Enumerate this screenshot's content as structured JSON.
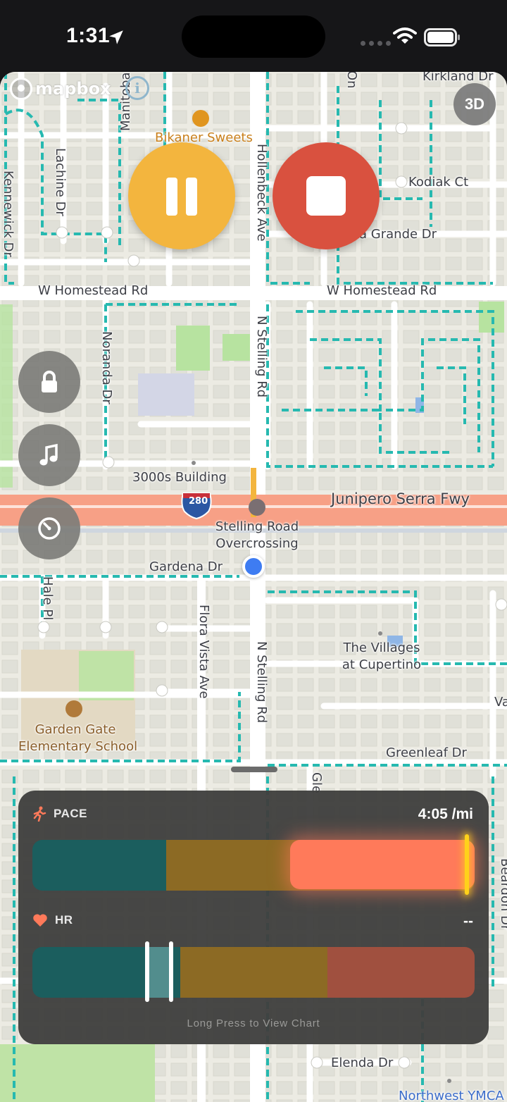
{
  "status_bar": {
    "time": "1:31",
    "location_icon": "location-arrow-icon",
    "wifi_icon": "wifi-icon",
    "battery_icon": "battery-icon"
  },
  "map": {
    "attribution": "mapbox",
    "info_icon": "info-icon",
    "info_glyph": "i",
    "view_toggle_label": "3D",
    "roads": {
      "kirkland": "Kirkland Dr",
      "kodiak": "Kodiak Ct",
      "la_grande": "La Grande Dr",
      "homestead_left": "W Homestead Rd",
      "homestead_right": "W Homestead Rd",
      "hollenbeck": "Hollenbeck Ave",
      "stelling_north": "N Stelling Rd",
      "stelling_south": "N Stelling Rd",
      "noranda": "Noranda Dr",
      "lachine": "Lachine Dr",
      "manitoba": "Manitoba Dr",
      "kennewick": "Kennewick Dr",
      "junipero": "Junipero Serra Fwy",
      "gardena": "Gardena Dr",
      "hale": "Hale Pl",
      "flora_vista": "Flora Vista Ave",
      "greenleaf": "Greenleaf Dr",
      "elenda": "Elenda Dr",
      "beardon": "Beardon Dr",
      "on_partial": "On",
      "gle_partial": "Gle",
      "va_partial": "Va",
      "interstate": "280"
    },
    "pois": {
      "bikaner": "Bikaner Sweets",
      "building_3000s": "3000s Building",
      "overcrossing_line1": "Stelling Road",
      "overcrossing_line2": "Overcrossing",
      "villages_line1": "The Villages",
      "villages_line2": "at Cupertino",
      "school_line1": "Garden Gate",
      "school_line2": "Elementary School",
      "ymca": "Northwest YMCA"
    }
  },
  "controls": {
    "pause_icon": "pause-icon",
    "stop_icon": "stop-icon",
    "lock_icon": "lock-icon",
    "music_icon": "music-note-icon",
    "gauge_icon": "gauge-icon"
  },
  "metrics_panel": {
    "pace": {
      "label": "PACE",
      "icon": "runner-icon",
      "value": "4:05 /mi",
      "zone_colors": [
        "#1b5e5e",
        "#8c6a24",
        "#ff7a5a"
      ],
      "current_zone": 3
    },
    "hr": {
      "label": "HR",
      "icon": "heart-icon",
      "value": "--",
      "zone_colors": [
        "#1b5e5e",
        "#8c6a24",
        "#a0503f"
      ]
    },
    "hint": "Long Press to View Chart"
  },
  "colors": {
    "pause": "#f3b53e",
    "stop": "#d9513f",
    "user_location": "#3e7cf2",
    "freeway": "#f7a086",
    "trail": "#26b9b0"
  }
}
